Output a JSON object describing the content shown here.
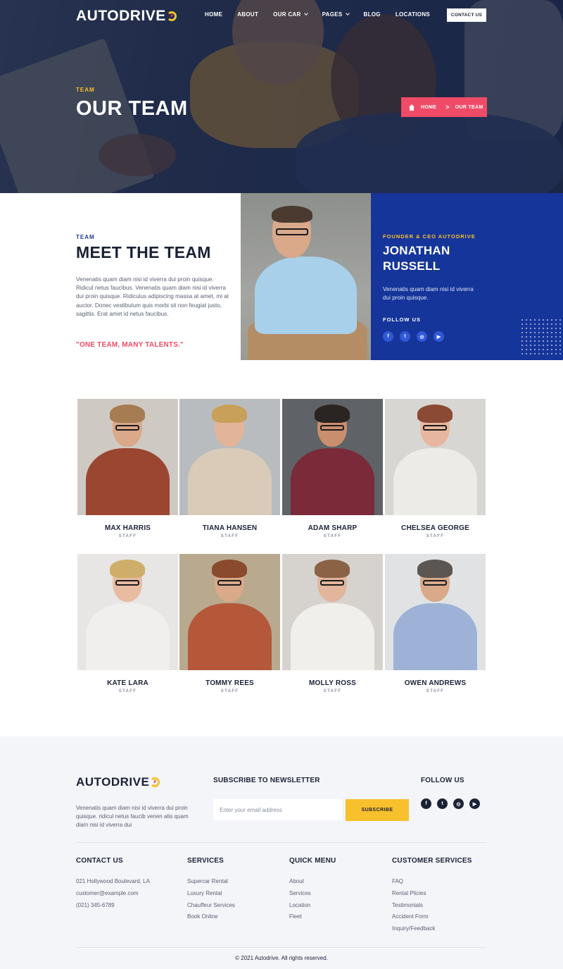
{
  "brand": {
    "name": "AUTODRIVE",
    "accent": "#f8c02c",
    "pink": "#ef4b67",
    "blue": "#16359a",
    "dark": "#1b2236"
  },
  "header": {
    "nav": [
      {
        "label": "HOME",
        "caret": false
      },
      {
        "label": "ABOUT",
        "caret": false
      },
      {
        "label": "OUR CAR",
        "caret": true
      },
      {
        "label": "PAGES",
        "caret": true
      },
      {
        "label": "BLOG",
        "caret": false
      },
      {
        "label": "LOCATIONS",
        "caret": false
      }
    ],
    "contact_button": "CONTACT US"
  },
  "hero": {
    "eyebrow": "TEAM",
    "title": "OUR TEAM",
    "breadcrumb": {
      "home": "HOME",
      "separator": ">",
      "current": "OUR TEAM"
    }
  },
  "meet": {
    "eyebrow": "TEAM",
    "title": "MEET THE TEAM",
    "paragraph": "Venenatis quam diam nisi id viverra dui proin quisque. Ridicul netus faucibus. Venenatis quam diam nisi id viverra dui proin quisque. Ridiculus adipiscing massa at amet, mi at auctor. Donec vestibulum quis morbi sit non feugiat justo, sagittis. Erat amet id netus faucibus.",
    "quote": "\"ONE TEAM, MANY TALENTS.\"",
    "ceo": {
      "role": "FOUNDER & CEO AUTODRIVE",
      "name": "JONATHAN RUSSELL",
      "bio": "Venenatis quam diam nisi id viverra dui proin quisque.",
      "follow_label": "FOLLOW US",
      "socials": [
        {
          "icon": "facebook-icon",
          "glyph": "f"
        },
        {
          "icon": "twitter-icon",
          "glyph": "t"
        },
        {
          "icon": "instagram-icon",
          "glyph": "◎"
        },
        {
          "icon": "youtube-icon",
          "glyph": "▶"
        }
      ]
    }
  },
  "team": [
    {
      "name": "MAX HARRIS",
      "role": "STAFF",
      "bg": "#cfc9c3",
      "skin": "#d9a98a",
      "hair": "#a67c52",
      "body": "#9b4630",
      "glasses": true
    },
    {
      "name": "TIANA HANSEN",
      "role": "STAFF",
      "bg": "#b8bcbf",
      "skin": "#e2b49a",
      "hair": "#c9a05a",
      "body": "#d9cbb8",
      "glasses": false
    },
    {
      "name": "ADAM SHARP",
      "role": "STAFF",
      "bg": "#5f6266",
      "skin": "#c98e6d",
      "hair": "#2a2422",
      "body": "#7a2a38",
      "glasses": true
    },
    {
      "name": "CHELSEA GEORGE",
      "role": "STAFF",
      "bg": "#d8d6d2",
      "skin": "#e6b79e",
      "hair": "#8a4a34",
      "body": "#ecebe8",
      "glasses": true
    },
    {
      "name": "KATE LARA",
      "role": "STAFF",
      "bg": "#e7e6e4",
      "skin": "#e8bba2",
      "hair": "#cfae6a",
      "body": "#f0efee",
      "glasses": true
    },
    {
      "name": "TOMMY REES",
      "role": "STAFF",
      "bg": "#b9a98e",
      "skin": "#d9a98a",
      "hair": "#8a4a2e",
      "body": "#b5583a",
      "glasses": true
    },
    {
      "name": "MOLLY ROSS",
      "role": "STAFF",
      "bg": "#d6d3cf",
      "skin": "#e3b59c",
      "hair": "#8a6346",
      "body": "#f1efeb",
      "glasses": true
    },
    {
      "name": "OWEN ANDREWS",
      "role": "STAFF",
      "bg": "#e0e2e4",
      "skin": "#d9a98a",
      "hair": "#5b5651",
      "body": "#9db2d6",
      "glasses": true
    }
  ],
  "footer": {
    "about": "Venenatis quam diam nisi id viverra dui proin quisque. ridicul netus faucib venen atis quam diam nisi id viverra dui",
    "newsletter": {
      "title": "SUBSCRIBE TO NEWSLETTER",
      "placeholder": "Enter your email address",
      "button": "SUBSCRIBE"
    },
    "follow_title": "FOLLOW US",
    "columns": [
      {
        "title": "CONTACT US",
        "items": [
          "021 Hollywood Boulevard, LA",
          "customer@example.com",
          "(021) 345-6789"
        ]
      },
      {
        "title": "SERVICES",
        "items": [
          "Supercar Rental",
          "Luxury Rental",
          "Chauffeur Services",
          "Book Online"
        ]
      },
      {
        "title": "QUICK MENU",
        "items": [
          "About",
          "Services",
          "Location",
          "Fleet"
        ]
      },
      {
        "title": "CUSTOMER SERVICES",
        "items": [
          "FAQ",
          "Rental Plicies",
          "Testimonials",
          "Accident Form",
          "Inquiry/Feedback"
        ]
      }
    ],
    "copyright": "© 2021 Autodrive. All rights reserved."
  }
}
